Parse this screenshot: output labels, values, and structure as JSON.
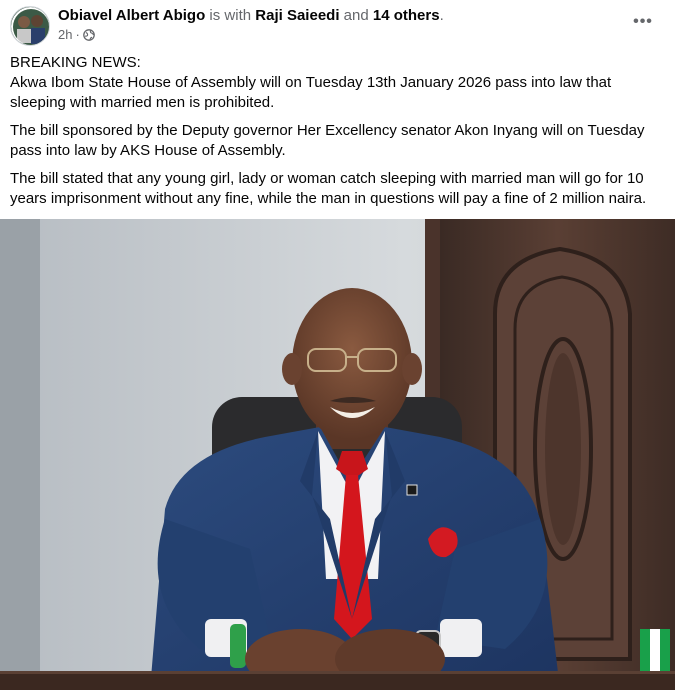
{
  "post": {
    "author": "Obiavel Albert Abigo",
    "with_text": "is with",
    "tagged_person": "Raji Saieedi",
    "and_text": "and",
    "others_text": "14 others",
    "period": ".",
    "timestamp": "2h",
    "separator": "·",
    "more_label": "•••",
    "headline": "BREAKING NEWS:",
    "paragraphs": [
      "Akwa Ibom State House of Assembly will on Tuesday 13th January 2026 pass into law that sleeping with married men is prohibited.",
      "The bill sponsored by the  Deputy governor Her Excellency senator Akon Inyang will on Tuesday pass into law by AKS House of Assembly.",
      "The bill stated that any young girl, lady  or woman catch sleeping with married man will go for 10 years imprisonment without any fine, while the man in questions will pay a fine of 2 million naira."
    ],
    "audience_icon": "globe-icon"
  },
  "colors": {
    "text_primary": "#050505",
    "text_secondary": "#65676b"
  }
}
